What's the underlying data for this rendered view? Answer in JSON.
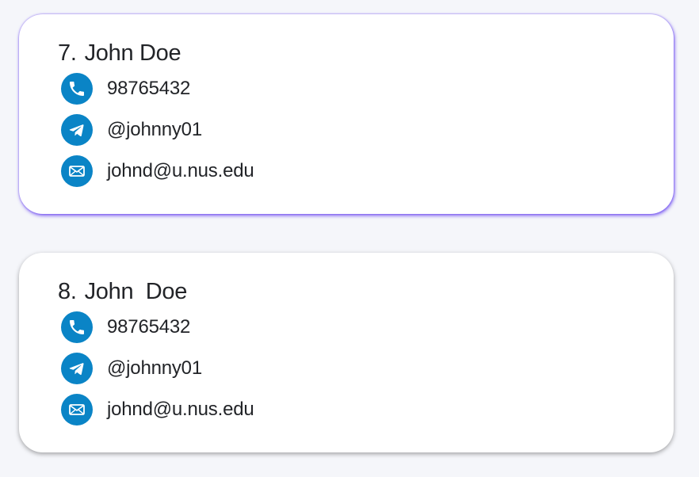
{
  "contacts": [
    {
      "index": "7.",
      "name": "John Doe",
      "phone": "98765432",
      "telegram": "@johnny01",
      "email": "johnd@u.nus.edu",
      "selected": true
    },
    {
      "index": "8.",
      "name": "John  Doe",
      "phone": "98765432",
      "telegram": "@johnny01",
      "email": "johnd@u.nus.edu",
      "selected": false
    }
  ],
  "colors": {
    "icon_background": "#0a84c6",
    "selection_glow": "#623cf0",
    "card_background": "#ffffff",
    "page_background": "#f5f6fa"
  },
  "icons": {
    "phone": "phone-icon",
    "telegram": "telegram-icon",
    "email": "email-icon"
  }
}
